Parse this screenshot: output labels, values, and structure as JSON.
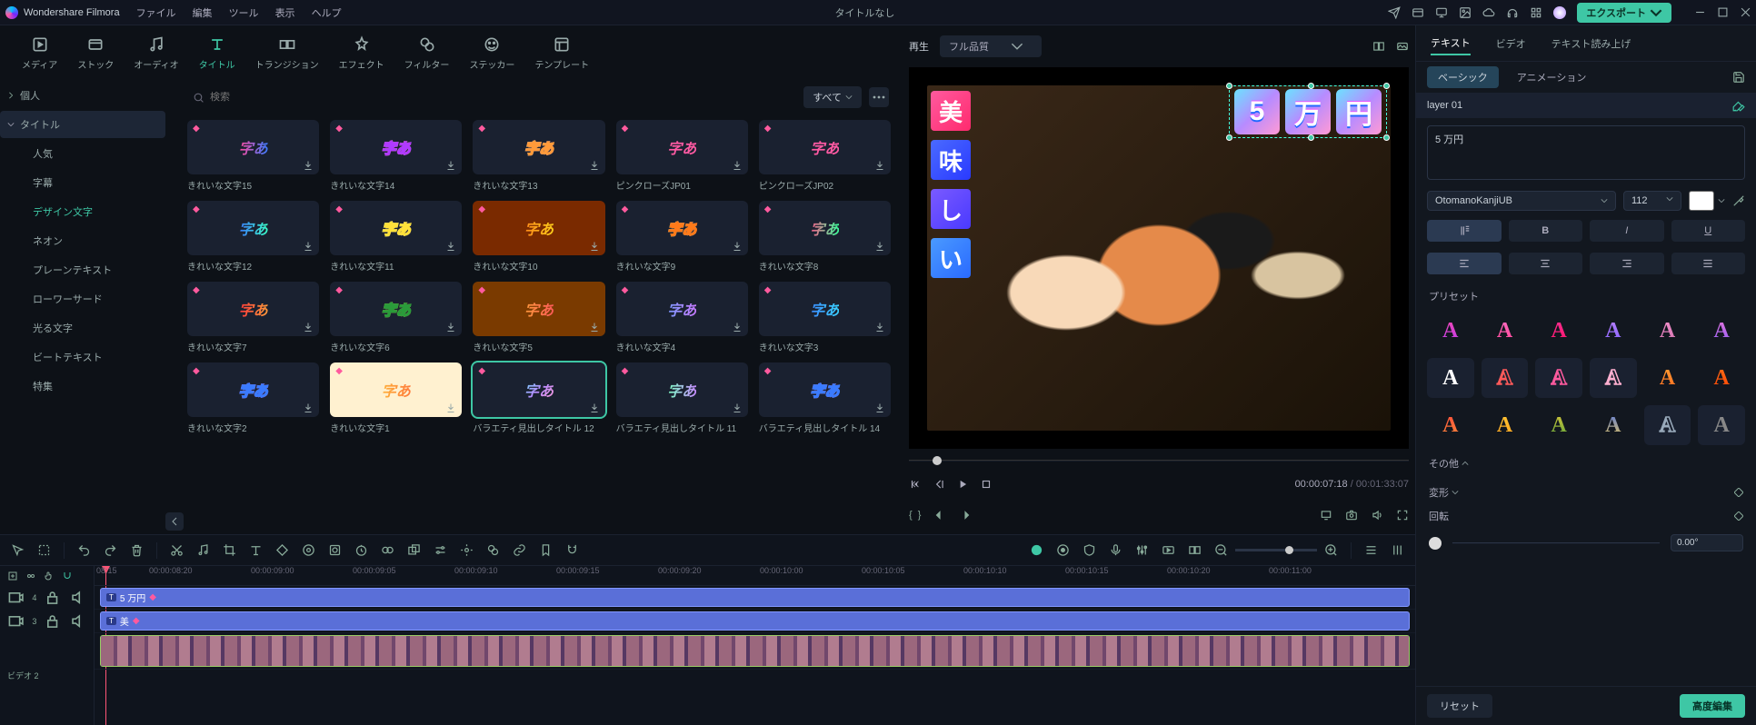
{
  "app": {
    "name": "Wondershare Filmora",
    "doc_title": "タイトルなし"
  },
  "menu": [
    "ファイル",
    "編集",
    "ツール",
    "表示",
    "ヘルプ"
  ],
  "export_label": "エクスポート",
  "top_tabs": [
    {
      "id": "media",
      "label": "メディア"
    },
    {
      "id": "stock",
      "label": "ストック"
    },
    {
      "id": "audio",
      "label": "オーディオ"
    },
    {
      "id": "title",
      "label": "タイトル",
      "active": true
    },
    {
      "id": "transition",
      "label": "トランジション"
    },
    {
      "id": "effect",
      "label": "エフェクト"
    },
    {
      "id": "filter",
      "label": "フィルター"
    },
    {
      "id": "sticker",
      "label": "ステッカー"
    },
    {
      "id": "template",
      "label": "テンプレート"
    }
  ],
  "sidebar": {
    "personal": "個人",
    "section": "タイトル",
    "items": [
      "人気",
      "字幕",
      "デザイン文字",
      "ネオン",
      "プレーンテキスト",
      "ローワーサード",
      "光る文字",
      "ビートテキスト",
      "特集"
    ],
    "active_index": 2
  },
  "search": {
    "placeholder": "検索",
    "filter": "すべて"
  },
  "thumbs": [
    {
      "cap": "きれいな文字15",
      "grad": "linear-gradient(90deg,#ff4aa0,#3a7bff)",
      "style": "italic"
    },
    {
      "cap": "きれいな文字14",
      "grad": "linear-gradient(90deg,#ff9a3a,#ffd13a)",
      "outline": "#b03aff"
    },
    {
      "cap": "きれいな文字13",
      "grad": "linear-gradient(90deg,#4aa0ff,#4a50ff)",
      "outline": "#ff9a3a"
    },
    {
      "cap": "ピンクローズJP01",
      "grad": "linear-gradient(90deg,#ff5aa3,#ff5aa3)"
    },
    {
      "cap": "ピンクローズJP02",
      "grad": "linear-gradient(90deg,#ff5aa3,#ff5aa3)"
    },
    {
      "cap": "きれいな文字12",
      "grad": "linear-gradient(90deg,#3a7bff,#3affc7)"
    },
    {
      "cap": "きれいな文字11",
      "grad": "linear-gradient(90deg,#3a7bff,#6a3aff)",
      "outline": "#ffe13a"
    },
    {
      "cap": "きれいな文字10",
      "grad": "linear-gradient(90deg,#ff8a1a,#ffcf1a)",
      "bg": "#7a2a00"
    },
    {
      "cap": "きれいな文字9",
      "grad": "linear-gradient(90deg,#3affff,#3a9bff)",
      "outline": "#ff7a1a"
    },
    {
      "cap": "きれいな文字8",
      "grad": "linear-gradient(90deg,#ff5a8a,#3aff9a)"
    },
    {
      "cap": "きれいな文字7",
      "grad": "linear-gradient(90deg,#ff3a3a,#ff9a3a)"
    },
    {
      "cap": "きれいな文字6",
      "grad": "linear-gradient(90deg,#ffd13a,#ff9a3a)",
      "outline": "#2a9b3a"
    },
    {
      "cap": "きれいな文字5",
      "grad": "linear-gradient(90deg,#ff9a3a,#ff5a5a)",
      "bg": "#7a3a00"
    },
    {
      "cap": "きれいな文字4",
      "grad": "linear-gradient(90deg,#7a9aff,#c77aff)"
    },
    {
      "cap": "きれいな文字3",
      "grad": "linear-gradient(90deg,#3a8aff,#3ad1ff)"
    },
    {
      "cap": "きれいな文字2",
      "grad": "linear-gradient(90deg,#ff7ad1,#ff3a8a)",
      "outline": "#3a7bff"
    },
    {
      "cap": "きれいな文字1",
      "grad": "linear-gradient(90deg,#ffb13a,#ff7a3a)",
      "bg": "#fff1d0",
      "dark": true
    },
    {
      "cap": "バラエティ見出しタイトル 12",
      "grad": "linear-gradient(135deg,#6be3ff,#b78bff,#ff9ad5)",
      "sel": true
    },
    {
      "cap": "バラエティ見出しタイトル 11",
      "grad": "linear-gradient(90deg,#7affc1,#c78aff)"
    },
    {
      "cap": "バラエティ見出しタイトル 14",
      "grad": "linear-gradient(90deg,#ff7a7a,#ff3a3a)",
      "outline": "#3a7bff"
    }
  ],
  "thumb_text": "字あ",
  "preview": {
    "play_label": "再生",
    "quality": "フル品質",
    "main_title_chars": [
      "5",
      "万",
      "円"
    ],
    "side_chars": [
      {
        "c": "美",
        "bg": "linear-gradient(135deg,#ff5a9e,#ff2a6e)"
      },
      {
        "c": "味",
        "bg": "linear-gradient(135deg,#4a6aff,#2a3aff)"
      },
      {
        "c": "し",
        "bg": "linear-gradient(135deg,#7a5aff,#4a3aff)"
      },
      {
        "c": "い",
        "bg": "linear-gradient(135deg,#4a9aff,#2a6aff)"
      }
    ],
    "timecode": "00:00:07:18",
    "duration": "00:01:33:07"
  },
  "inspector": {
    "tabs": [
      "テキスト",
      "ビデオ",
      "テキスト読み上げ"
    ],
    "subtabs": [
      "ベーシック",
      "アニメーション"
    ],
    "layer": "layer 01",
    "text": "5 万円",
    "font": "OtomanoKanjiUB",
    "size": "112",
    "preset_label": "プリセット",
    "other_label": "その他",
    "transform_label": "変形",
    "rotate_label": "回転",
    "rotate_value": "0.00°",
    "reset": "リセット",
    "advanced": "高度編集",
    "presets": [
      "linear-gradient(180deg,#ff4aa0,#b03aff)",
      "linear-gradient(180deg,#ff7ad1,#ff3a8a)",
      "linear-gradient(180deg,#ff3aa0,#ff0a60)",
      "linear-gradient(180deg,#c78aff,#7a5aff)",
      "linear-gradient(180deg,#ff9ad5,#c76aa5)",
      "linear-gradient(180deg,#ff7ad1,#7a5aff)",
      "#ffffff",
      "#ff5a5a outline",
      "#ff5a9e outline",
      "#ffb0d0 outline",
      "linear-gradient(180deg,#ffb13a,#ff5a1a)",
      "linear-gradient(180deg,#ff7a1a,#ff3a00)",
      "linear-gradient(180deg,#ff3a3a,#ff9a3a)",
      "linear-gradient(180deg,#ffd13a,#ff9a1a)",
      "linear-gradient(180deg,#ffd13a,#3a9b3a)",
      "linear-gradient(180deg,#3a6aff,#ffd13a)",
      "#9ab outline",
      "#888"
    ]
  },
  "timeline": {
    "start": "08:15",
    "ticks": [
      "00:00:08:20",
      "00:00:09:00",
      "00:00:09:05",
      "00:00:09:10",
      "00:00:09:15",
      "00:00:09:20",
      "00:00:10:00",
      "00:00:10:05",
      "00:00:10:10",
      "00:00:10:15",
      "00:00:10:20",
      "00:00:11:00"
    ],
    "track_t1": {
      "label": "5 万円"
    },
    "track_t2": {
      "label": "美"
    },
    "left_labels": {
      "t4": "4",
      "t3": "3",
      "v": "ビデオ 2"
    }
  }
}
